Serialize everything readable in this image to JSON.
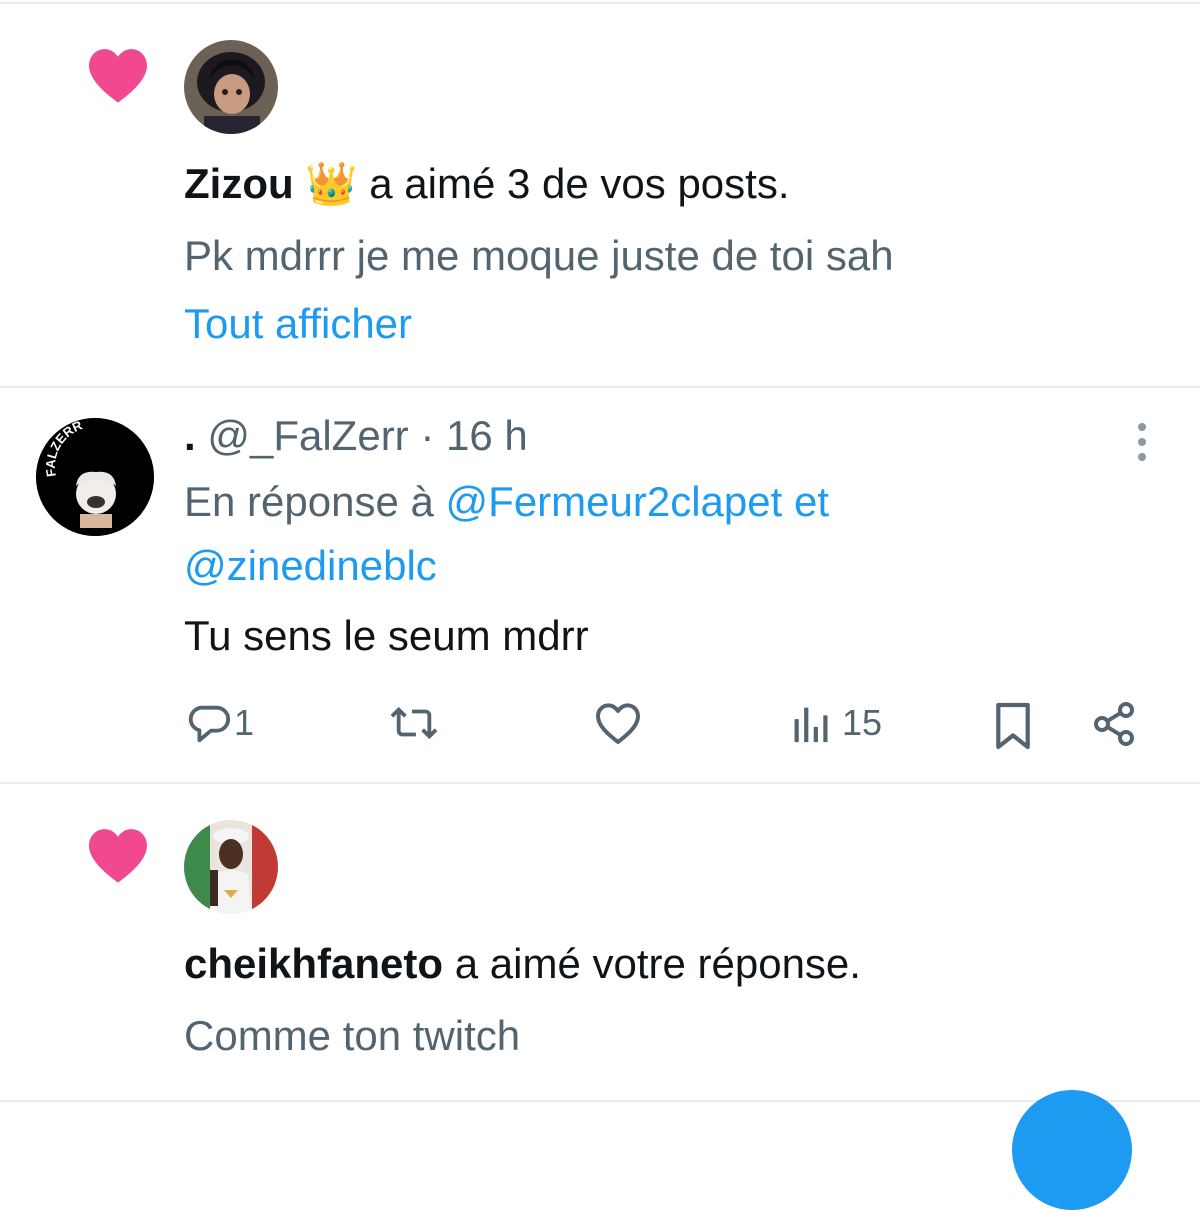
{
  "notifications": [
    {
      "type": "like",
      "user": "Zizou",
      "user_badge": "👑",
      "action": "a aimé 3 de vos posts.",
      "preview": "Pk mdrrr je me moque juste de toi sah",
      "show_all": "Tout afficher"
    },
    {
      "type": "reply",
      "display_name": ".",
      "handle": "@_FalZerr",
      "separator": "·",
      "time": "16 h",
      "reply_prefix": "En réponse à",
      "mention_1": "@Fermeur2clapet",
      "mention_joiner": "et",
      "mention_2": "@zinedineblc",
      "text": "Tu sens le seum mdrr",
      "avatar_text": "FALZERR",
      "replies": "1",
      "views": "15"
    },
    {
      "type": "like",
      "user": "cheikhfaneto",
      "action": "a aimé votre réponse.",
      "preview": "Comme ton twitch"
    }
  ],
  "colors": {
    "like": "#f0498f",
    "link": "#1d9bf0",
    "muted": "#536471",
    "text": "#0f1419"
  },
  "icons": [
    "heart-icon",
    "more-icon",
    "reply-icon",
    "retweet-icon",
    "like-icon",
    "views-icon",
    "bookmark-icon",
    "share-icon"
  ]
}
